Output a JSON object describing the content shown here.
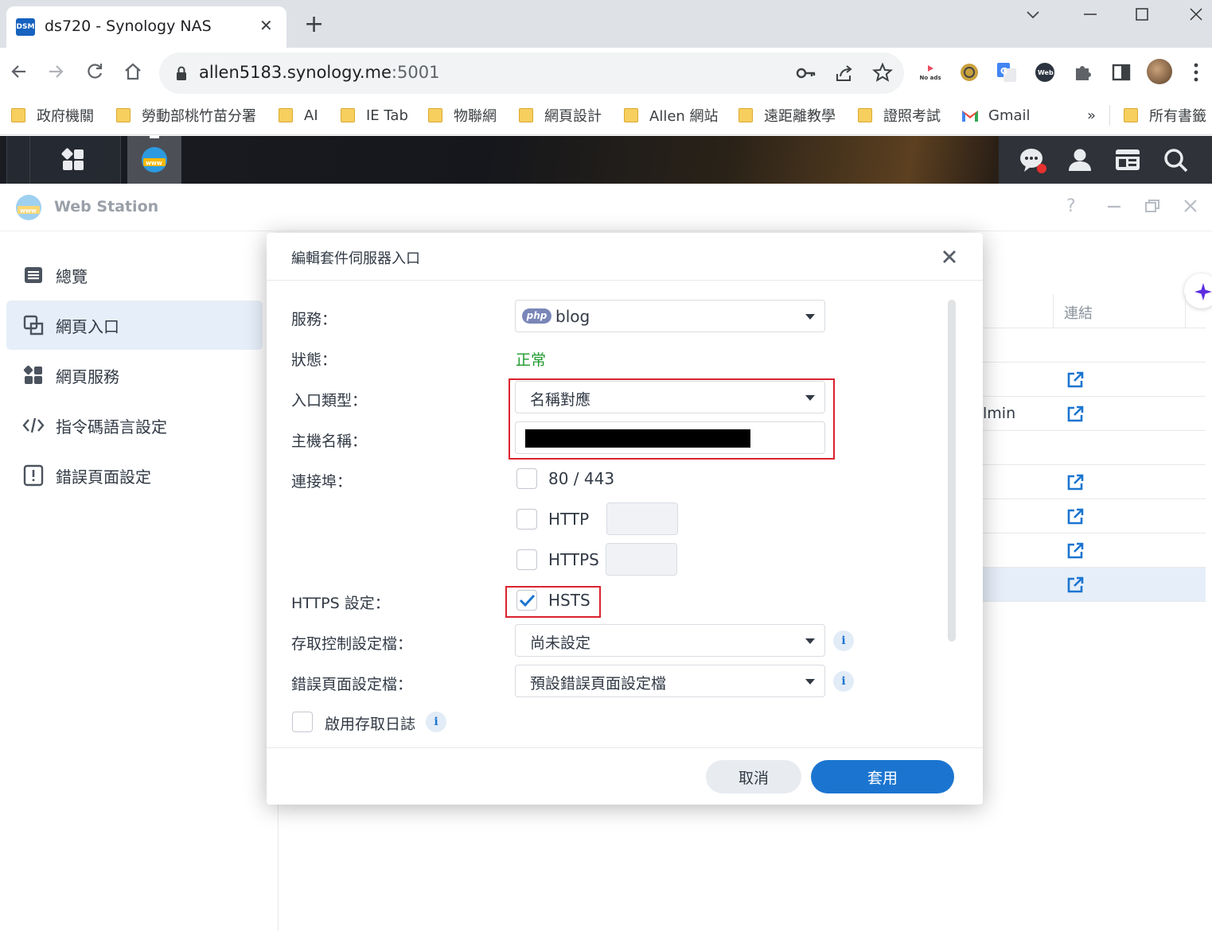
{
  "browser": {
    "tab_title": "ds720 - Synology NAS",
    "tab_favicon_text": "DSM",
    "url_host": "allen5183.synology.me",
    "url_port": ":5001",
    "no_ads_label": "No ads",
    "bookmarks": [
      "政府機關",
      "勞動部桃竹苗分署",
      "AI",
      "IE Tab",
      "物聯網",
      "網頁設計",
      "Allen 網站",
      "遠距離教學",
      "證照考試",
      "Gmail"
    ],
    "bookmarks_more": "»",
    "all_bookmarks": "所有書籤"
  },
  "window": {
    "title": "Web Station"
  },
  "sidebar": {
    "items": [
      {
        "label": "總覽",
        "icon": "overview-icon"
      },
      {
        "label": "網頁入口",
        "icon": "web-portal-icon"
      },
      {
        "label": "網頁服務",
        "icon": "web-service-icon"
      },
      {
        "label": "指令碼語言設定",
        "icon": "code-icon"
      },
      {
        "label": "錯誤頁面設定",
        "icon": "error-page-icon"
      }
    ],
    "active_index": 1
  },
  "background_table": {
    "column_header": "連結",
    "partial_cell": "lmin"
  },
  "dialog": {
    "title": "編輯套件伺服器入口",
    "service_label": "服務：",
    "service_value": "blog",
    "service_badge": "php",
    "status_label": "狀態：",
    "status_value": "正常",
    "portal_type_label": "入口類型：",
    "portal_type_value": "名稱對應",
    "hostname_label": "主機名稱：",
    "port_label": "連接埠：",
    "port_80_443": "80 / 443",
    "port_http": "HTTP",
    "port_https": "HTTPS",
    "https_settings_label": "HTTPS 設定：",
    "hsts_label": "HSTS",
    "hsts_checked": true,
    "access_control_label": "存取控制設定檔：",
    "access_control_value": "尚未設定",
    "error_page_label": "錯誤頁面設定檔：",
    "error_page_value": "預設錯誤頁面設定檔",
    "enable_log_label": "啟用存取日誌",
    "cancel_label": "取消",
    "apply_label": "套用",
    "info_glyph": "i"
  },
  "colors": {
    "accent": "#1b75d0",
    "status_ok": "#1e9a2c",
    "highlight_red": "#d9232e"
  }
}
